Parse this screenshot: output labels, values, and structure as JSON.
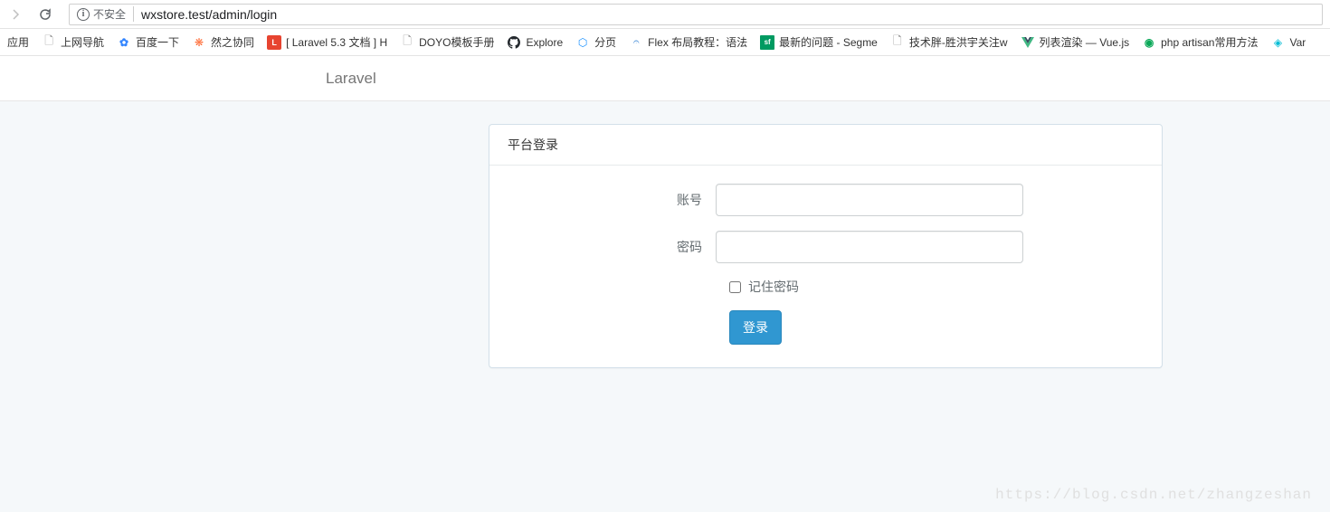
{
  "browser": {
    "security_label": "不安全",
    "url": "wxstore.test/admin/login"
  },
  "bookmarks": [
    {
      "label": "应用",
      "icon": ""
    },
    {
      "label": "上网导航",
      "icon": "file"
    },
    {
      "label": "百度一下",
      "icon": "baidu"
    },
    {
      "label": "然之协同",
      "icon": "fire"
    },
    {
      "label": "[ Laravel 5.3 文档 ] H",
      "icon": "laravel"
    },
    {
      "label": "DOYO模板手册",
      "icon": "file"
    },
    {
      "label": "Explore",
      "icon": "github"
    },
    {
      "label": "分页",
      "icon": "blue"
    },
    {
      "label": "Flex 布局教程：语法",
      "icon": "flex"
    },
    {
      "label": "最新的问题 - Segme",
      "icon": "sf"
    },
    {
      "label": "技术胖-胜洪宇关注w",
      "icon": "file"
    },
    {
      "label": "列表渲染 — Vue.js",
      "icon": "vue"
    },
    {
      "label": "php artisan常用方法",
      "icon": "green"
    },
    {
      "label": "Var",
      "icon": "cyan"
    }
  ],
  "page": {
    "brand": "Laravel",
    "panel_title": "平台登录",
    "form": {
      "username_label": "账号",
      "password_label": "密码",
      "remember_label": "记住密码",
      "submit_label": "登录"
    }
  },
  "watermark": "https://blog.csdn.net/zhangzeshan"
}
